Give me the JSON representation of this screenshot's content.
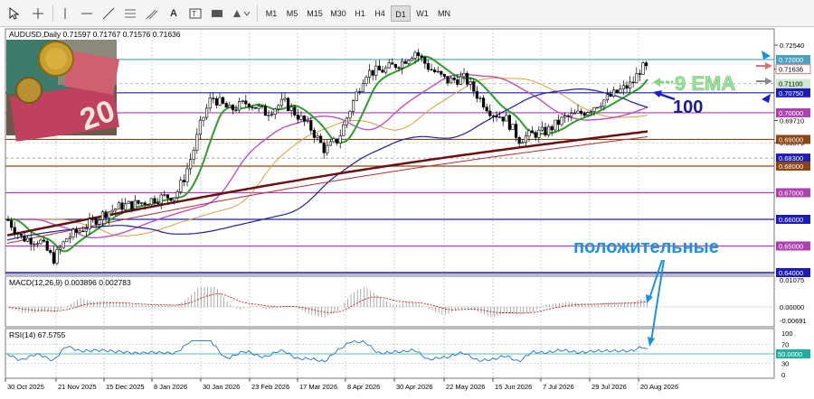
{
  "toolbar": {
    "tools": [
      "cursor-icon",
      "crosshair-icon",
      "vertical-line-icon",
      "horizontal-line-icon",
      "trendline-icon",
      "channel-icon",
      "text-icon",
      "label-icon",
      "rectangle-icon",
      "shapes-icon"
    ],
    "timeframes": [
      "M1",
      "M5",
      "M15",
      "M30",
      "H1",
      "H4",
      "D1",
      "W1",
      "MN"
    ],
    "active_timeframe": "D1"
  },
  "chart": {
    "header": "AUDUSD,Daily  0.71597 0.71767 0.71576 0.71636",
    "symbol": "AUDUSD",
    "timeframe": "Daily",
    "ohlc": {
      "open": 0.71597,
      "high": 0.71767,
      "low": 0.71576,
      "close": 0.71636
    },
    "price_labels": [
      "0.72540",
      "0.72000",
      "0.71636",
      "0.71100",
      "0.70750",
      "0.70000",
      "0.69710",
      "0.69000",
      "0.68876",
      "0.68300",
      "0.68000",
      "0.67000",
      "0.66000",
      "0.65000",
      "0.64000"
    ],
    "date_labels": [
      "30 Oct 2025",
      "21 Nov 2025",
      "15 Dec 2025",
      "8 Jan 2026",
      "30 Jan 2026",
      "23 Feb 2026",
      "17 Mar 2026",
      "8 Apr 2026",
      "30 Apr 2026",
      "22 May 2026",
      "15 Jun 2026",
      "7 Jul 2026",
      "29 Jul 2026",
      "20 Aug 2026"
    ],
    "annotation_ema": "9 EMA",
    "annotation_ma": "100",
    "annotation_positive": "положительные",
    "colors": {
      "level_blue": "#1c1cb8",
      "level_purple": "#b040b0",
      "level_brown": "#8b4513",
      "ema_green": "#2aa02a",
      "ma_blue": "#2020a0",
      "ma_red": "#8b1a1a",
      "annot_blue": "#1e90e0",
      "annot_green": "#7fd67f"
    }
  },
  "macd": {
    "header": "MACD(12,26,9) 0.003896 0.002783",
    "scale": [
      "0.01075",
      "0.00000",
      "-0.00691"
    ]
  },
  "rsi": {
    "header": "RSI(14) 67.5755",
    "scale": [
      "100",
      "70",
      "50.0000",
      "30",
      "0"
    ]
  }
}
